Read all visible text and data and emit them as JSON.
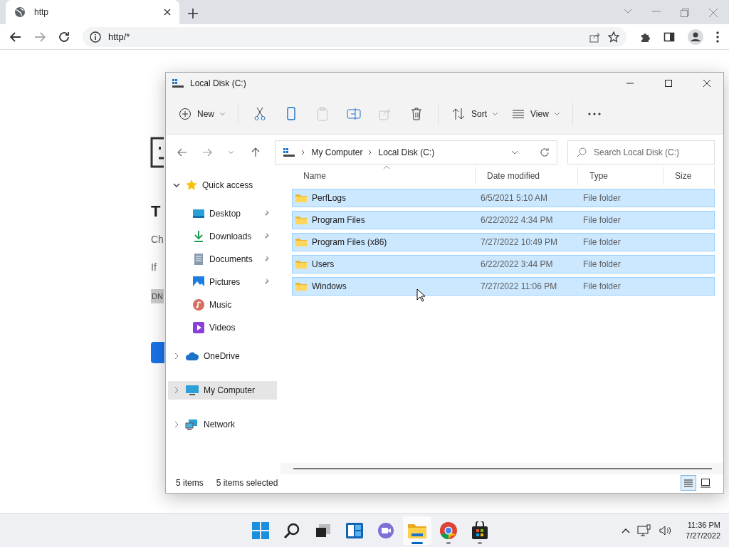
{
  "browser": {
    "tab": {
      "title": "http",
      "selected": true
    },
    "address": "http/*"
  },
  "page": {
    "heading": "T",
    "lines": [
      "Ch",
      "If"
    ],
    "code": "DN"
  },
  "explorer": {
    "title": "Local Disk (C:)",
    "toolbar": [
      {
        "kind": "new",
        "label": "New",
        "disabled": false
      },
      {
        "kind": "separator"
      },
      {
        "kind": "cut",
        "disabled": false
      },
      {
        "kind": "copy",
        "disabled": false
      },
      {
        "kind": "paste",
        "disabled": true
      },
      {
        "kind": "rename",
        "disabled": false
      },
      {
        "kind": "share",
        "disabled": true
      },
      {
        "kind": "delete",
        "disabled": false
      },
      {
        "kind": "separator"
      },
      {
        "kind": "sort",
        "label": "Sort",
        "disabled": false
      },
      {
        "kind": "view",
        "label": "View",
        "disabled": false
      },
      {
        "kind": "separator"
      },
      {
        "kind": "more",
        "disabled": false
      }
    ],
    "path": [
      "My Computer",
      "Local Disk (C:)"
    ],
    "search": {
      "placeholder": "Search Local Disk (C:)"
    },
    "nav": [
      {
        "kind": "star",
        "label": "Quick access",
        "expanded": true,
        "selected": false,
        "children": [
          {
            "kind": "desktop",
            "label": "Desktop",
            "pinned": true
          },
          {
            "kind": "downloads",
            "label": "Downloads",
            "pinned": true
          },
          {
            "kind": "documents",
            "label": "Documents",
            "pinned": true
          },
          {
            "kind": "pictures",
            "label": "Pictures",
            "pinned": true
          },
          {
            "kind": "music",
            "label": "Music",
            "pinned": false
          },
          {
            "kind": "videos",
            "label": "Videos",
            "pinned": false
          }
        ]
      },
      {
        "kind": "cloud",
        "label": "OneDrive",
        "expanded": false,
        "selected": false
      },
      {
        "kind": "computer",
        "label": "My Computer",
        "expanded": false,
        "selected": true
      },
      {
        "kind": "network",
        "label": "Network",
        "expanded": false,
        "selected": false
      }
    ],
    "columns": [
      "Name",
      "Date modified",
      "Type",
      "Size"
    ],
    "rows": [
      {
        "name": "PerfLogs",
        "date": "6/5/2021 5:10 AM",
        "type": "File folder",
        "selected": true
      },
      {
        "name": "Program Files",
        "date": "6/22/2022 4:34 PM",
        "type": "File folder",
        "selected": true
      },
      {
        "name": "Program Files (x86)",
        "date": "7/27/2022 10:49 PM",
        "type": "File folder",
        "selected": true
      },
      {
        "name": "Users",
        "date": "6/22/2022 3:44 PM",
        "type": "File folder",
        "selected": true
      },
      {
        "name": "Windows",
        "date": "7/27/2022 11:06 PM",
        "type": "File folder",
        "selected": true
      }
    ],
    "status": {
      "count": "5 items",
      "selection": "5 items selected"
    },
    "views": [
      {
        "kind": "details",
        "selected": true
      },
      {
        "kind": "tiles",
        "selected": false
      }
    ]
  },
  "taskbar": {
    "apps": [
      {
        "kind": "start",
        "running": false,
        "selected": false
      },
      {
        "kind": "search",
        "running": false,
        "selected": false
      },
      {
        "kind": "taskview",
        "running": false,
        "selected": false
      },
      {
        "kind": "widgets",
        "running": false,
        "selected": false
      },
      {
        "kind": "chat",
        "running": false,
        "selected": false
      },
      {
        "kind": "explorer",
        "running": true,
        "selected": true
      },
      {
        "kind": "browser",
        "running": true,
        "selected": false
      },
      {
        "kind": "store",
        "running": true,
        "selected": false
      }
    ],
    "time": "11:36 PM",
    "date": "7/27/2022"
  }
}
